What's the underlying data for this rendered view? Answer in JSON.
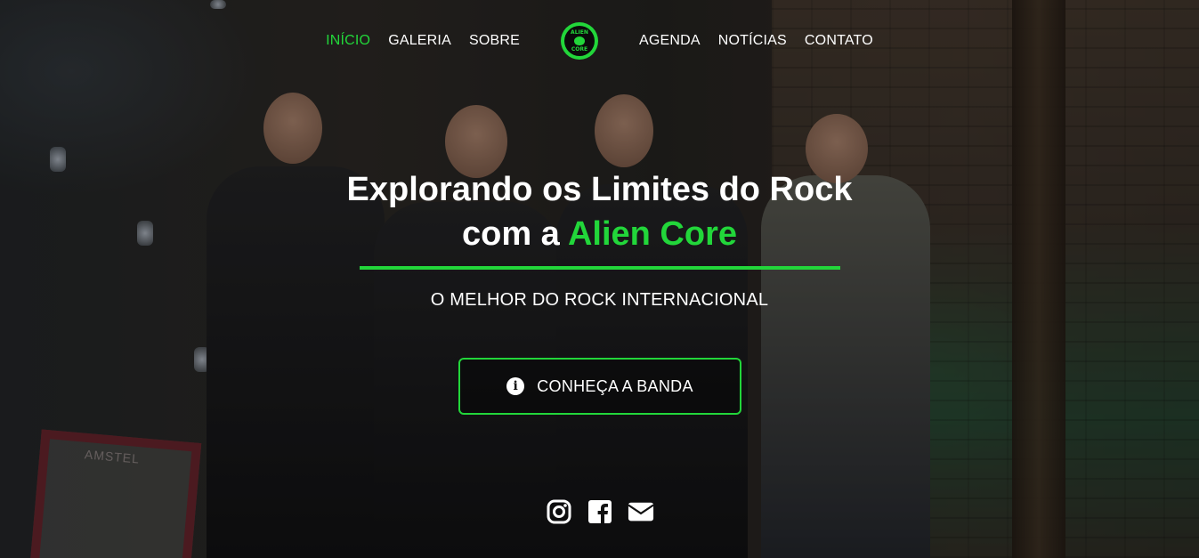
{
  "nav": {
    "left_items": [
      {
        "label": "INÍCIO",
        "active": true
      },
      {
        "label": "GALERIA",
        "active": false
      },
      {
        "label": "SOBRE",
        "active": false
      }
    ],
    "right_items": [
      {
        "label": "AGENDA",
        "active": false
      },
      {
        "label": "NOTÍCIAS",
        "active": false
      },
      {
        "label": "CONTATO",
        "active": false
      }
    ],
    "logo": {
      "top_text": "ALIEN",
      "bottom_text": "CORE"
    }
  },
  "hero": {
    "headline_line1": "Explorando os Limites do Rock",
    "headline_line2_prefix": "com a ",
    "headline_line2_accent": "Alien Core",
    "subtitle": "O MELHOR DO ROCK INTERNACIONAL",
    "cta": {
      "label": "CONHEÇA A BANDA",
      "icon": "info-circle-icon"
    },
    "background_sign": "AMSTEL"
  },
  "social": [
    {
      "icon": "instagram-icon"
    },
    {
      "icon": "facebook-icon"
    },
    {
      "icon": "envelope-icon"
    }
  ],
  "colors": {
    "accent": "#22d63a",
    "text": "#ffffff"
  }
}
